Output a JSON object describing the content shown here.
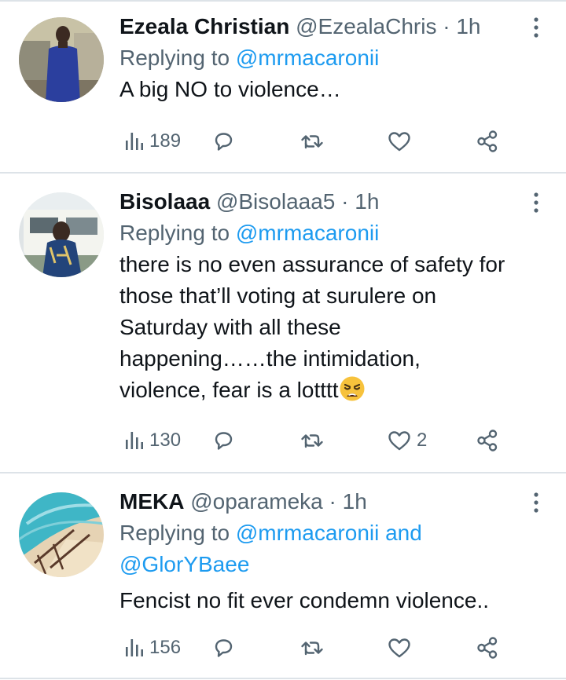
{
  "colors": {
    "link": "#1d9bf0",
    "secondary": "#536471",
    "primary": "#0f1419",
    "separator": "#dde3e8"
  },
  "tweets": [
    {
      "name": "Ezeala Christian",
      "handle": "@EzealaChris",
      "dot": "·",
      "time": "1h",
      "replying_prefix": "Replying to",
      "replying_to": "@mrmacaronii",
      "replying_line2": "",
      "text_lines": [
        "A big NO to violence…"
      ],
      "views": "189",
      "replies": "",
      "retweets": "",
      "likes": ""
    },
    {
      "name": "Bisolaaa",
      "handle": "@Bisolaaa5",
      "dot": "·",
      "time": "1h",
      "replying_prefix": "Replying to",
      "replying_to": "@mrmacaronii",
      "replying_line2": "",
      "text_lines": [
        "there is no even assurance of safety for",
        "those that’ll voting at surulere on",
        "Saturday with all these",
        "happening……the intimidation,",
        "violence, fear is a lotttt"
      ],
      "emoji": "weary-face-icon",
      "views": "130",
      "replies": "",
      "retweets": "",
      "likes": "2"
    },
    {
      "name": "MEKA",
      "handle": "@oparameka",
      "dot": "·",
      "time": "1h",
      "replying_prefix": "Replying to",
      "replying_to": "@mrmacaronii and",
      "replying_line2": "@GlorYBaee",
      "text_lines": [
        "Fencist no fit ever condemn violence.."
      ],
      "views": "156",
      "replies": "",
      "retweets": "",
      "likes": ""
    }
  ]
}
